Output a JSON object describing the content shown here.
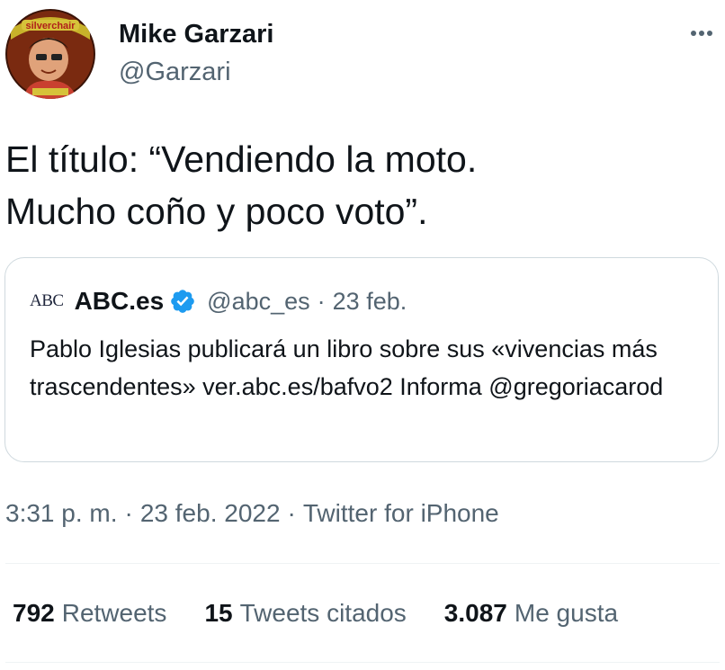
{
  "author": {
    "display_name": "Mike Garzari",
    "handle": "@Garzari",
    "avatar_text": "silverchair"
  },
  "tweet": {
    "text": "El título: “Vendiendo la moto.\nMucho coño y poco voto”."
  },
  "quoted": {
    "logo_text": "ABC",
    "display_name": "ABC.es",
    "handle": "@abc_es",
    "separator": "·",
    "date": "23 feb.",
    "text": "Pablo Iglesias publicará un libro sobre sus «vivencias más trascendentes» ver.abc.es/bafvo2 Informa @gregoriacarod"
  },
  "meta": {
    "time": "3:31 p. m.",
    "separator": "·",
    "date": "23 feb. 2022",
    "source": "Twitter for iPhone"
  },
  "stats": {
    "retweets": {
      "count": "792",
      "label": "Retweets"
    },
    "quote_tweets": {
      "count": "15",
      "label": "Tweets citados"
    },
    "likes": {
      "count": "3.087",
      "label": "Me gusta"
    }
  },
  "colors": {
    "text": "#0f1419",
    "secondary": "#536471",
    "border": "#cfd9de",
    "verified": "#1d9bf0"
  },
  "icons": {
    "more": "more-dots-icon",
    "verified": "verified-badge-icon"
  }
}
